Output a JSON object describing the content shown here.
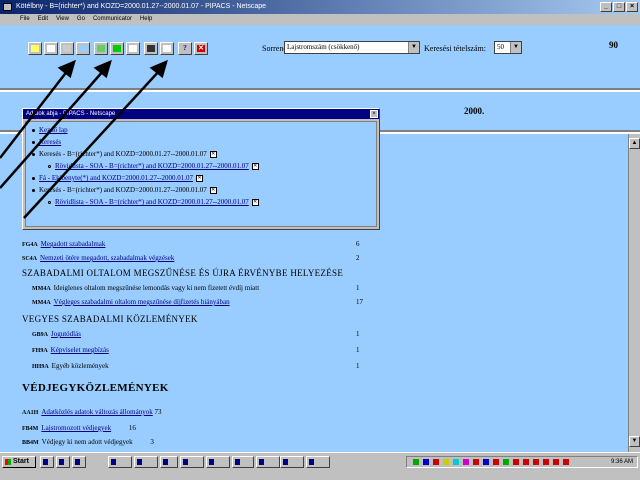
{
  "window": {
    "title": "Kötélbny - B=(richter*) and KOZD=2000.01.27--2000.01.07 - PIPACS - Netscape",
    "min": "_",
    "max": "□",
    "close": "×"
  },
  "menu": [
    "File",
    "Edit",
    "View",
    "Go",
    "Communicator",
    "Help"
  ],
  "toolbar": {
    "sort_label": "Sorrend:",
    "sort_value": "Lajstromszám (csökkenő)",
    "count_label": "Keresési tételszám:",
    "count_value": "50",
    "total": "90",
    "buttons": [
      {
        "icon": "pencil-icon",
        "color": "#ffff66"
      },
      {
        "icon": "document-icon",
        "color": "#ffffff"
      },
      {
        "icon": "printer-icon",
        "color": "#cccccc"
      },
      {
        "icon": "image-icon",
        "color": "#99ccff"
      },
      {
        "icon": "map-icon",
        "color": "#66cc66"
      },
      {
        "icon": "green-light-icon",
        "color": "#00cc00"
      },
      {
        "icon": "list-icon",
        "color": "#ffffff"
      },
      {
        "icon": "lines-icon",
        "color": "#333333"
      },
      {
        "icon": "blank-page-icon",
        "color": "#ffffff"
      },
      {
        "icon": "help-icon",
        "color": "#c0c0c0",
        "glyph": "?"
      },
      {
        "icon": "close-icon",
        "color": "#cc0000",
        "glyph": "✕"
      }
    ]
  },
  "year": "2000.",
  "popup": {
    "title": "Adatok abja - PIPACS - Netscape",
    "close": "×",
    "items": [
      {
        "text": "Kezdő lap",
        "level": 0
      },
      {
        "text": "Keresés",
        "level": 0
      },
      {
        "text": "Keresés - B=(richter*) and KOZD=2000.01.27--2000.01.07",
        "level": 0,
        "x": true
      },
      {
        "text": "Rövidlista - SOA - B=(richter*) and KOZD=2000.01.27--2000.01.07",
        "level": 1,
        "x": true
      },
      {
        "text": "Fá - Ekibenyte(*) and KOZD=2000.01.27--2000.01.07",
        "level": 0,
        "x": true
      },
      {
        "text": "Keresés - B=(richter*) and KOZD=2000.01.27--2000.01.07",
        "level": 0,
        "x": true
      },
      {
        "text": "Rövidlista - SOA - B=(richter*) and KOZD=2000.01.27--2000.01.07",
        "level": 1,
        "x": true
      }
    ]
  },
  "main": {
    "rows": [
      {
        "code": "FG4A",
        "text": "Megadott szabadalmak",
        "count": "6"
      },
      {
        "code": "SC4A",
        "text": "Nemzeti ötére megadott, szabadalmak végzések",
        "count": "2"
      }
    ],
    "section1": "SZABADALMI OLTALOM MEGSZŰNÉSE ÉS ÚJRA ÉRVÉNYBE HELYEZÉSE",
    "rows2": [
      {
        "code": "MM4A",
        "text": "Ideiglenes oltalom megszűnése lemondás vagy ki nem fizetett évdíj miatt",
        "count": "1"
      },
      {
        "code": "MM4A",
        "text": "Végleges szabadalmi oltalom megszűnése díjfizetés hiányában",
        "count": "17"
      }
    ],
    "section2": "VEGYES SZABADALMI KÖZLEMÉNYEK",
    "rows3": [
      {
        "code": "GB9A",
        "text": "Jogutódlás",
        "count": "1"
      },
      {
        "code": "FH9A",
        "text": "Képviselet megbízás",
        "count": "1"
      },
      {
        "code": "HH9A",
        "text": "Egyéb közlemények",
        "count": "1"
      }
    ],
    "section3": "VÉDJEGYKÖZLEMÉNYEK",
    "rows4": [
      {
        "code": "AA1H",
        "text": "Adatközlés adatok változás állományok",
        "count": "73"
      },
      {
        "code": "FB4M",
        "text": "Lajstromozott védjegyek",
        "count": "16"
      },
      {
        "code": "BB4M",
        "text": "Védjegy ki nem adott védjegyek",
        "count": "3"
      }
    ]
  },
  "taskbar": {
    "start": "Start",
    "items": [
      "",
      "",
      "",
      "",
      "",
      "",
      "",
      "",
      "",
      "",
      "",
      ""
    ],
    "clock": "9:36 AM"
  }
}
